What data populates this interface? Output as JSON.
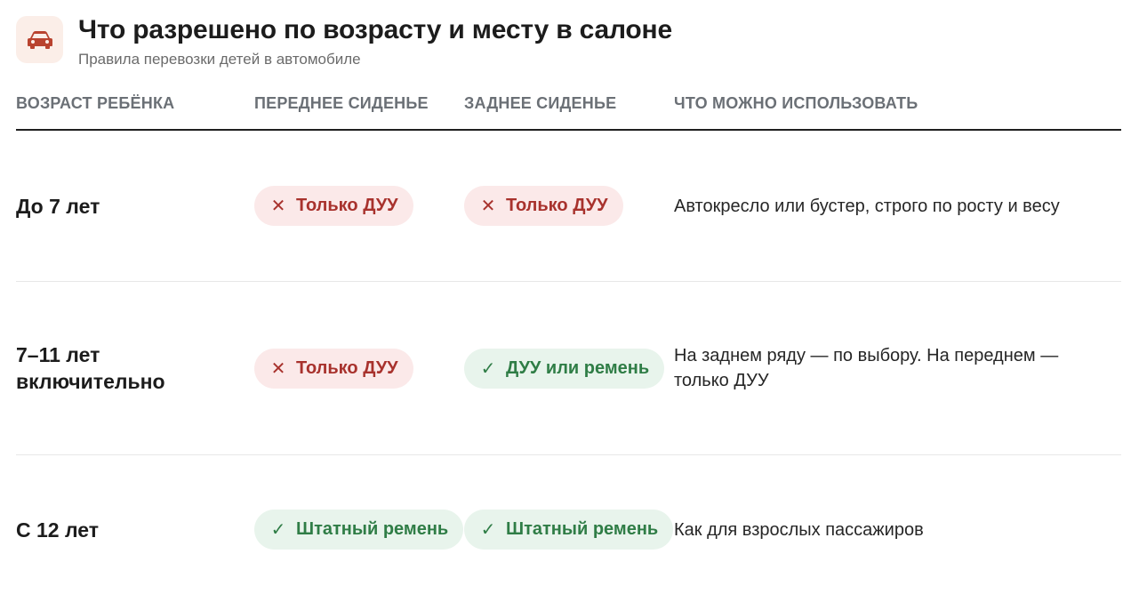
{
  "header": {
    "icon": "car-icon",
    "title": "Что разрешено по возрасту и месту в салоне",
    "subtitle": "Правила перевозки детей в автомобиле"
  },
  "table": {
    "columns": [
      "ВОЗРАСТ РЕБЁНКА",
      "ПЕРЕДНЕЕ СИДЕНЬЕ",
      "ЗАДНЕЕ СИДЕНЬЕ",
      "ЧТО МОЖНО ИСПОЛЬЗОВАТЬ"
    ],
    "rows": [
      {
        "age": "До 7 лет",
        "front": {
          "status": "bad",
          "icon": "cross-icon",
          "label": "Только ДУУ"
        },
        "rear": {
          "status": "bad",
          "icon": "cross-icon",
          "label": "Только ДУУ"
        },
        "note": "Автокресло или бустер, строго по росту и весу"
      },
      {
        "age_line1": "7–11 лет",
        "age_line2": "включительно",
        "front": {
          "status": "bad",
          "icon": "cross-icon",
          "label": "Только ДУУ"
        },
        "rear": {
          "status": "good",
          "icon": "check-icon",
          "label": "ДУУ или ремень"
        },
        "note": "На заднем ряду — по выбору. На переднем — только ДУУ"
      },
      {
        "age": "С 12 лет",
        "front": {
          "status": "good",
          "icon": "check-icon",
          "label": "Штатный ремень"
        },
        "rear": {
          "status": "good",
          "icon": "check-icon",
          "label": "Штатный ремень"
        },
        "note": "Как для взрослых пассажиров"
      }
    ]
  },
  "colors": {
    "bad_bg": "#fbe9e9",
    "bad_text": "#a8322d",
    "good_bg": "#e8f4ec",
    "good_text": "#2f7d46",
    "icon_accent": "#b9432f",
    "icon_bg": "#fbeee8"
  }
}
